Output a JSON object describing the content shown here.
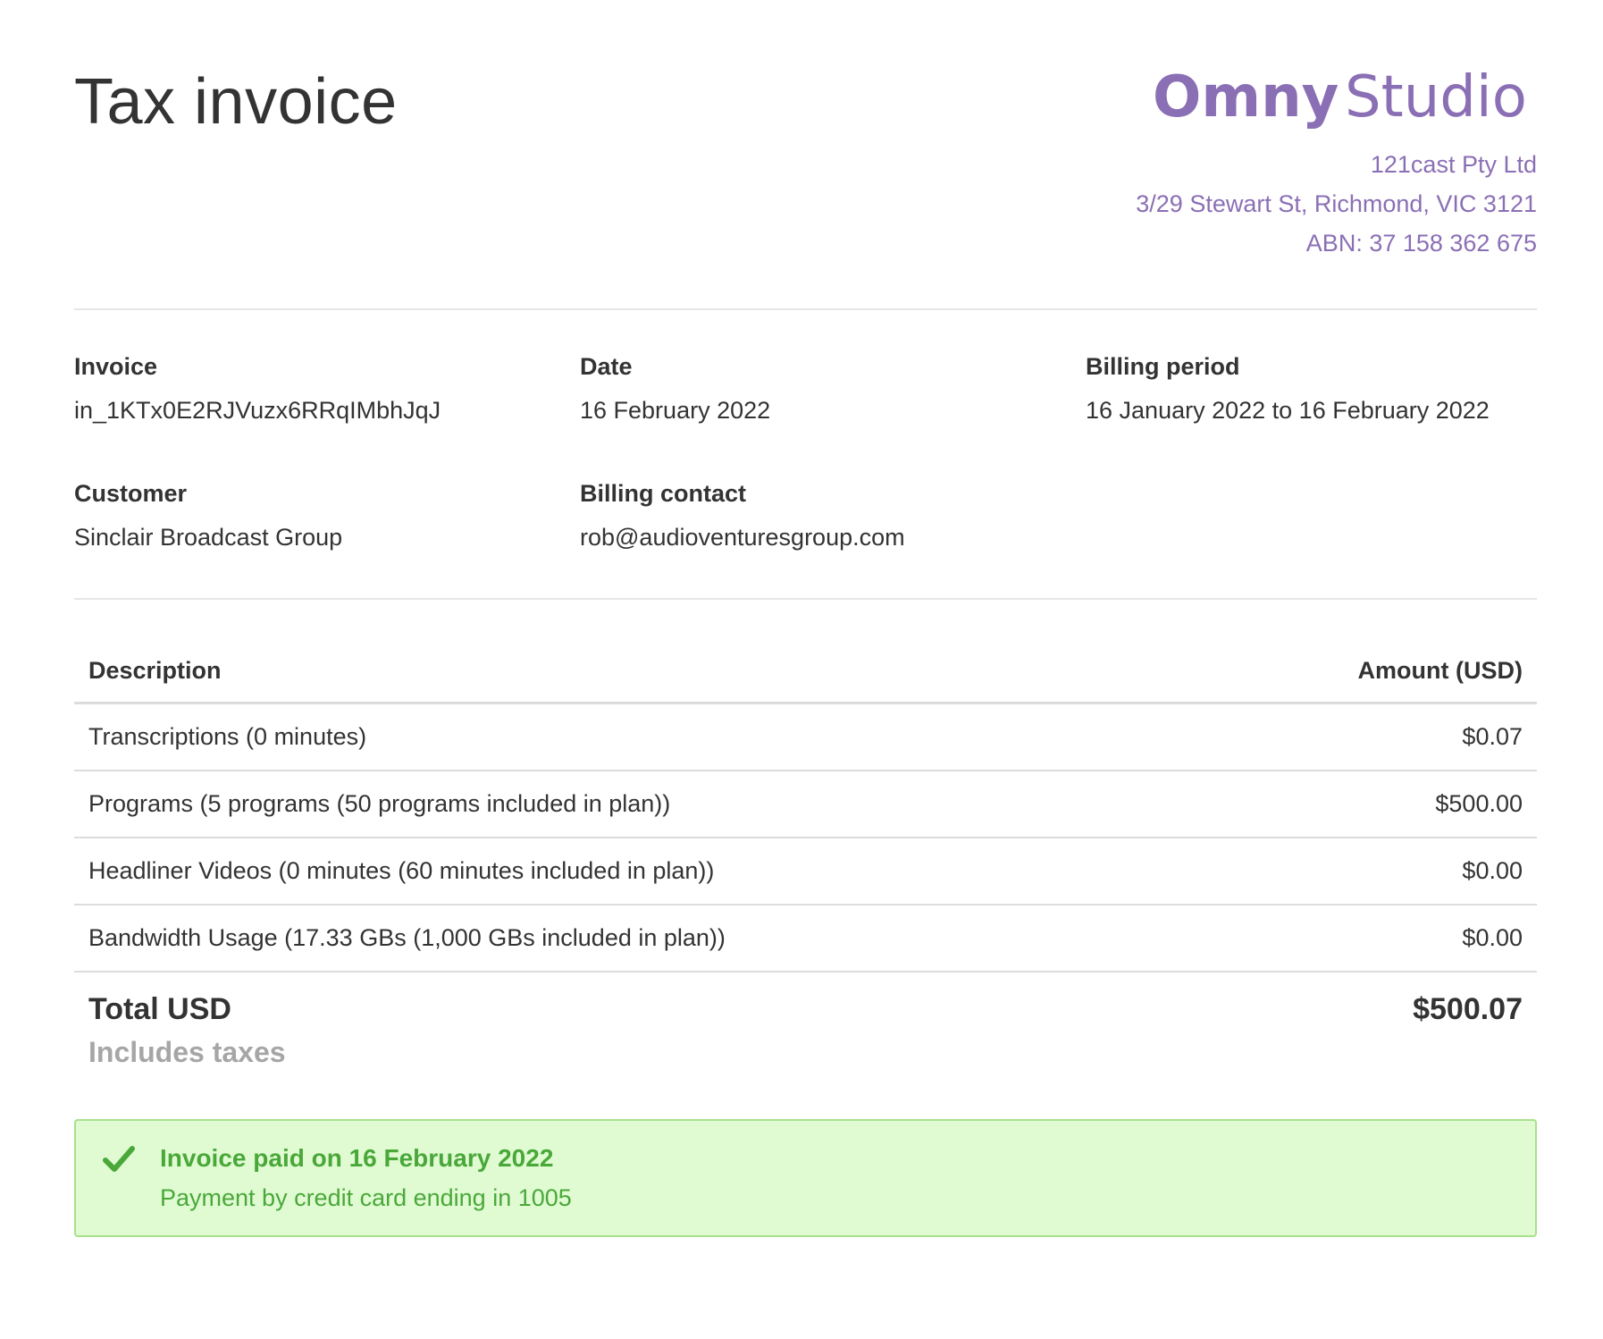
{
  "header": {
    "title": "Tax invoice",
    "brand": {
      "logo_text_1": "Omny",
      "logo_text_2": "Studio",
      "company": "121cast Pty Ltd",
      "address": "3/29 Stewart St, Richmond, VIC 3121",
      "abn": "ABN: 37 158 362 675"
    }
  },
  "details": {
    "invoice": {
      "label": "Invoice",
      "value": "in_1KTx0E2RJVuzx6RRqIMbhJqJ"
    },
    "date": {
      "label": "Date",
      "value": "16 February 2022"
    },
    "billing_period": {
      "label": "Billing period",
      "value": "16 January 2022 to 16 February 2022"
    },
    "customer": {
      "label": "Customer",
      "value": "Sinclair Broadcast Group"
    },
    "billing_contact": {
      "label": "Billing contact",
      "value": "rob@audioventuresgroup.com"
    }
  },
  "table": {
    "headers": {
      "description": "Description",
      "amount": "Amount (USD)"
    },
    "rows": [
      {
        "description": "Transcriptions (0 minutes)",
        "amount": "$0.07"
      },
      {
        "description": "Programs (5 programs (50 programs included in plan))",
        "amount": "$500.00"
      },
      {
        "description": "Headliner Videos (0 minutes (60 minutes included in plan))",
        "amount": "$0.00"
      },
      {
        "description": "Bandwidth Usage (17.33 GBs (1,000 GBs included in plan))",
        "amount": "$0.00"
      }
    ],
    "total": {
      "label": "Total USD",
      "sublabel": "Includes taxes",
      "value": "$500.07"
    }
  },
  "payment": {
    "title": "Invoice paid on 16 February 2022",
    "subtitle": "Payment by credit card ending in 1005",
    "icon": "checkmark-icon"
  },
  "colors": {
    "brand": "#8B6FB5",
    "text": "#333333",
    "muted": "#a6a6a6",
    "success_bg": "#e0fbd2",
    "success_border": "#a9e08d",
    "success_text": "#4aa83a"
  }
}
